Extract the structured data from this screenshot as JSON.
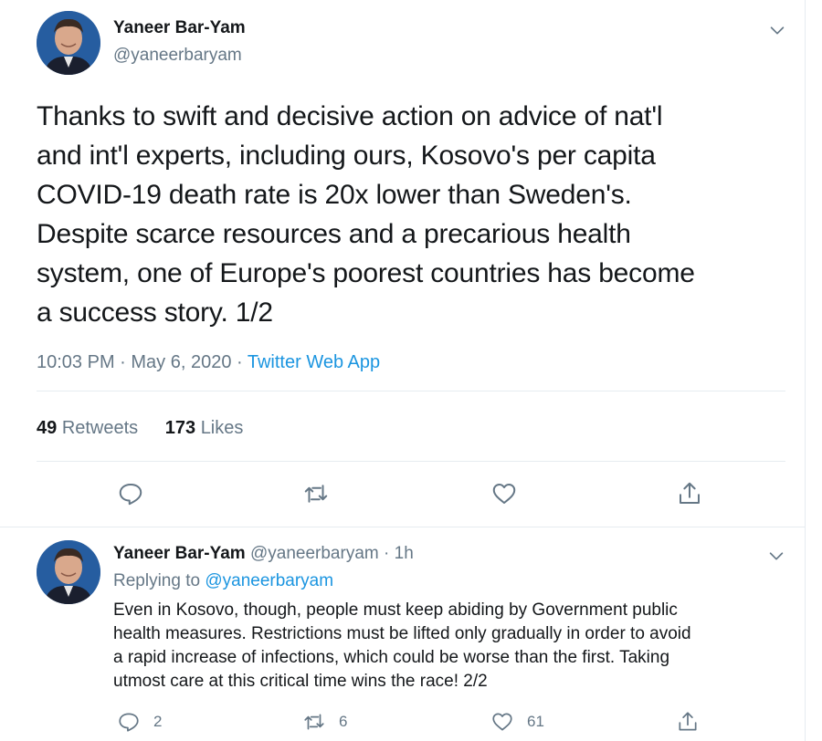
{
  "main_tweet": {
    "author_name": "Yaneer Bar-Yam",
    "author_handle": "@yaneerbaryam",
    "text": "Thanks to swift and decisive action on advice of nat'l\nand int'l experts, including ours, Kosovo's per capita\nCOVID-19 death rate is 20x lower than Sweden's.\nDespite scarce resources and a precarious health\nsystem, one of Europe's poorest countries has become\na success story. 1/2",
    "time": "10:03 PM · May 6, 2020 · ",
    "source": "Twitter Web App",
    "retweets_count": "49",
    "retweets_label": "Retweets",
    "likes_count": "173",
    "likes_label": "Likes"
  },
  "reply_tweet": {
    "author_name": "Yaneer Bar-Yam",
    "author_handle": "@yaneerbaryam",
    "time": "· 1h",
    "replying_prefix": "Replying to ",
    "replying_to": "@yaneerbaryam",
    "text": "Even in Kosovo, though, people must keep abiding by Government public\nhealth measures. Restrictions must be lifted only gradually in order to avoid\na rapid increase of infections, which could be worse than the first. Taking\nutmost care at this critical time wins the race! 2/2",
    "reply_count": "2",
    "retweet_count": "6",
    "like_count": "61"
  },
  "colors": {
    "text": "#14171a",
    "secondary": "#657786",
    "link": "#1b95e0",
    "divider": "#e6ecf0"
  },
  "icons": [
    "chevron-down-icon",
    "reply-icon",
    "retweet-icon",
    "like-icon",
    "share-icon"
  ]
}
